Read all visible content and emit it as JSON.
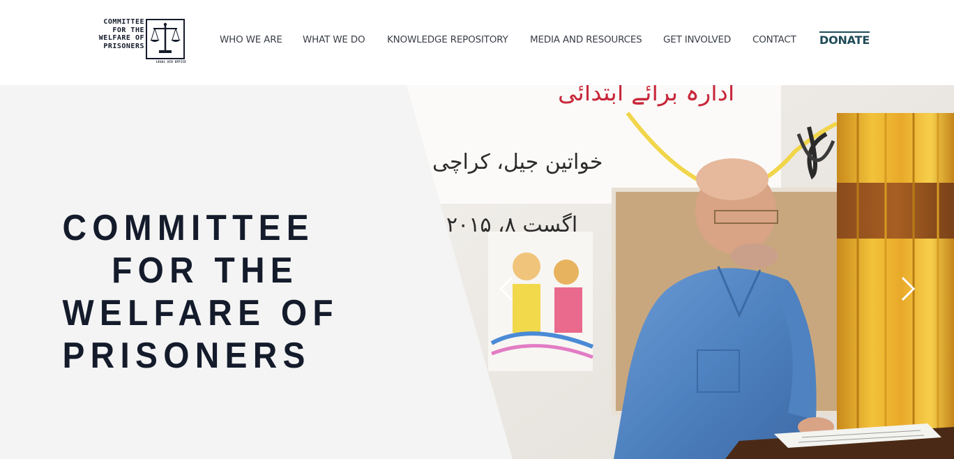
{
  "header": {
    "logo": {
      "lines": [
        "COMMITTEE",
        "FOR THE",
        "WELFARE OF",
        "PRISONERS"
      ],
      "subtitle": "LEGAL AID OFFICE"
    },
    "nav": [
      {
        "label": "WHO WE ARE"
      },
      {
        "label": "WHAT WE DO"
      },
      {
        "label": "KNOWLEDGE REPOSITORY"
      },
      {
        "label": "MEDIA AND RESOURCES"
      },
      {
        "label": "GET INVOLVED"
      },
      {
        "label": "CONTACT"
      }
    ],
    "donate_label": "DONATE"
  },
  "hero": {
    "title_lines": [
      "COMMITTEE",
      "FOR THE",
      "WELFARE OF",
      "PRISONERS"
    ],
    "banner_text": [
      "ادارہ برائے ابتدائی",
      "خواتین جیل، کراچی",
      "اگست ۸، ۲۰۱۵"
    ],
    "prev_icon": "chevron-left-icon",
    "next_icon": "chevron-right-icon"
  },
  "colors": {
    "brand_navy": "#141b2b",
    "donate_teal": "#1f4a57",
    "nav_text": "#3a3f47",
    "hero_bg": "#f4f4f4"
  }
}
